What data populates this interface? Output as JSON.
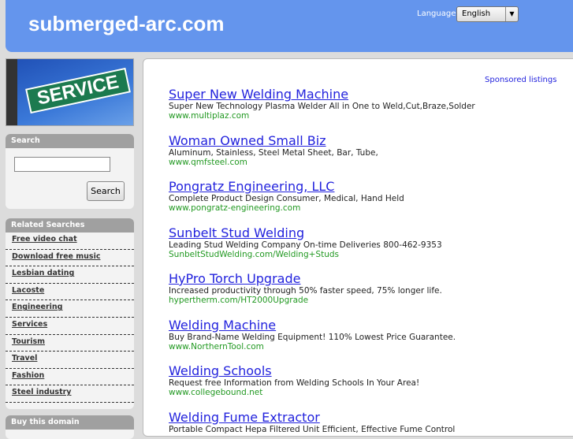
{
  "header": {
    "site_title": "submerged-arc.com",
    "language_label": "Language:",
    "language_value": "English"
  },
  "banner": {
    "sign_text": "SERVICE"
  },
  "search": {
    "title": "Search",
    "input_value": "",
    "button_label": "Search"
  },
  "related": {
    "title": "Related Searches",
    "items": [
      "Free video chat",
      "Download free music",
      "Lesbian dating",
      "Lacoste",
      "Engineering",
      "Services",
      "Tourism",
      "Travel",
      "Fashion",
      "Steel industry"
    ]
  },
  "buy": {
    "title": "Buy this domain"
  },
  "main": {
    "sponsored_label": "Sponsored listings",
    "listings": [
      {
        "title": "Super New Welding Machine",
        "desc": "Super New Technology Plasma Welder All in One to Weld,Cut,Braze,Solder",
        "url": "www.multiplaz.com"
      },
      {
        "title": "Woman Owned Small Biz",
        "desc": "Aluminum, Stainless, Steel Metal Sheet, Bar, Tube,",
        "url": "www.qmfsteel.com"
      },
      {
        "title": "Pongratz Engineering, LLC",
        "desc": "Complete Product Design Consumer, Medical, Hand Held",
        "url": "www.pongratz-engineering.com"
      },
      {
        "title": "Sunbelt Stud Welding",
        "desc": "Leading Stud Welding Company On-time Deliveries 800-462-9353",
        "url": "SunbeltStudWelding.com/Welding+Studs"
      },
      {
        "title": "HyPro Torch Upgrade",
        "desc": "Increased productivity through 50% faster speed, 75% longer life.",
        "url": "hypertherm.com/HT2000Upgrade"
      },
      {
        "title": "Welding Machine",
        "desc": "Buy Brand-Name Welding Equipment! 110% Lowest Price Guarantee.",
        "url": "www.NorthernTool.com"
      },
      {
        "title": "Welding Schools",
        "desc": "Request free Information from Welding Schools In Your Area!",
        "url": "www.collegebound.net"
      },
      {
        "title": "Welding Fume Extractor",
        "desc": "Portable Compact Hepa Filtered Unit Efficient, Effective Fume Control",
        "url": ""
      }
    ]
  }
}
